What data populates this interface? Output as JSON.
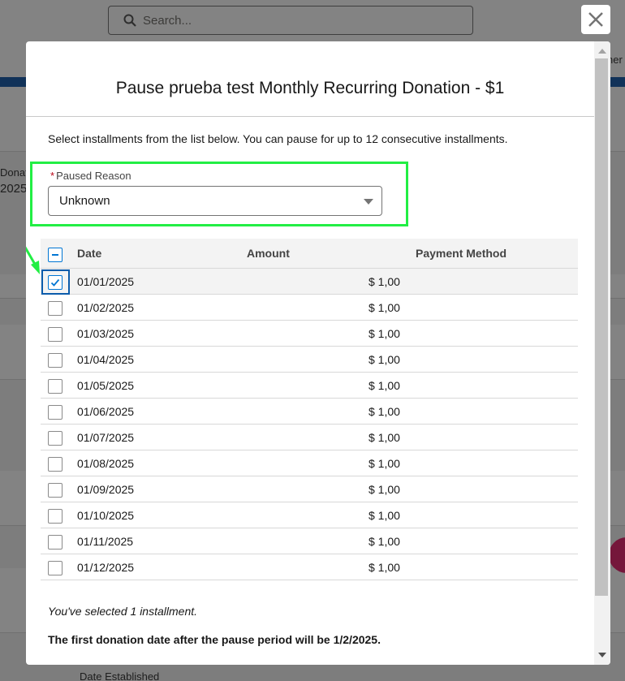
{
  "background": {
    "search_placeholder": "Search...",
    "left_label": "Donat",
    "left_value": "2025",
    "right_label": "ner",
    "bottom_label": "Date Established"
  },
  "modal": {
    "title": "Pause prueba test Monthly Recurring Donation - $1",
    "instructions": "Select installments from the list below. You can pause for up to 12 consecutive installments.",
    "paused_reason": {
      "required_marker": "*",
      "label": "Paused Reason",
      "value": "Unknown"
    },
    "table": {
      "headers": {
        "date": "Date",
        "amount": "Amount",
        "payment_method": "Payment Method"
      },
      "rows": [
        {
          "date": "01/01/2025",
          "amount": "$ 1,00",
          "checked": true
        },
        {
          "date": "01/02/2025",
          "amount": "$ 1,00",
          "checked": false
        },
        {
          "date": "01/03/2025",
          "amount": "$ 1,00",
          "checked": false
        },
        {
          "date": "01/04/2025",
          "amount": "$ 1,00",
          "checked": false
        },
        {
          "date": "01/05/2025",
          "amount": "$ 1,00",
          "checked": false
        },
        {
          "date": "01/06/2025",
          "amount": "$ 1,00",
          "checked": false
        },
        {
          "date": "01/07/2025",
          "amount": "$ 1,00",
          "checked": false
        },
        {
          "date": "01/08/2025",
          "amount": "$ 1,00",
          "checked": false
        },
        {
          "date": "01/09/2025",
          "amount": "$ 1,00",
          "checked": false
        },
        {
          "date": "01/10/2025",
          "amount": "$ 1,00",
          "checked": false
        },
        {
          "date": "01/11/2025",
          "amount": "$ 1,00",
          "checked": false
        },
        {
          "date": "01/12/2025",
          "amount": "$ 1,00",
          "checked": false
        }
      ]
    },
    "selected_summary": "You've selected 1 installment.",
    "first_date_message": "The first donation date after the pause period will be 1/2/2025."
  },
  "colors": {
    "brand_blue": "#0176d3",
    "highlight_green": "#22ee44",
    "required_red": "#ba0517"
  },
  "icons": {
    "close": "close-icon",
    "search": "search-icon",
    "dropdown": "chevron-down-icon",
    "check": "check-icon",
    "indeterminate": "minus-icon",
    "annotation": "arrow-annotation-icon"
  }
}
